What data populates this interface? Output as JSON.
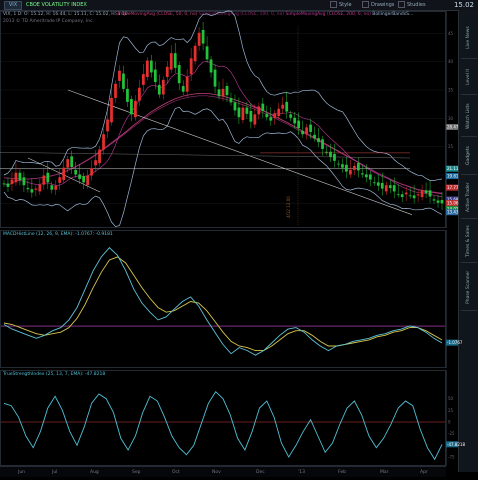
{
  "header": {
    "symbol": "VIX",
    "title": "CBOE VOLATILITY INDEX",
    "tools": [
      "Style",
      "Drawings",
      "Studies"
    ],
    "last_price": "15.02"
  },
  "price_legend": {
    "ohlc": "VIX, 1 D: O: 15.12, H: 16.44, L: 15.11, C: 15.02, H: 1.10",
    "source": "2013 © TD Ameritrade IP Company, Inc.",
    "studies": [
      "SimpleMovingAvg (CLOSE, 50, 0, no)",
      "SimpleMovingAvg (CLOSE, 100, 0, no)",
      "SimpleMovingAvg (CLOSE, 200, 0, no)",
      "BollingerBandsS..."
    ],
    "annotation": "4/12 12:00",
    "level_tags": [
      "28.47",
      "21.11",
      "19.81",
      "17.77",
      "15.68",
      "15.06",
      "14.02",
      "13.43"
    ]
  },
  "macd_legend": {
    "text": "MACDHistLine (12, 26, 9, EMA): -1.0767: -0.9181",
    "tag": "-1.0767"
  },
  "tsi_legend": {
    "text": "TrueStrengthIndex (25, 13, 7, EMA): -47.8218",
    "tag": "-47.8218"
  },
  "sidebar": [
    "Live News",
    "Level II",
    "Watch Lists",
    "Gadgets",
    "Active Trader",
    "Times & Sales",
    "Phase Scanner"
  ],
  "colors": {
    "up": "#23c23a",
    "down": "#e53030",
    "bb": "#9fb8d8",
    "sma50": "#c0407a",
    "sma100": "#8a2a6a",
    "sma200": "#c03a9a",
    "trend": "#cfcfcf",
    "macd": "#5ec3d8",
    "signal": "#d6c64a",
    "tsi": "#4fc0d6",
    "zero": "#d04ad0",
    "refline": "#d04040"
  },
  "chart_data": [
    {
      "type": "candlestick",
      "title": "VIX",
      "categories": [
        "Jun",
        "Jul",
        "Aug",
        "Sep",
        "Oct",
        "Nov",
        "Dec",
        "'13",
        "Feb",
        "Mar",
        "Apr"
      ],
      "ylim": [
        11,
        47
      ],
      "yticks": [
        45,
        40,
        35,
        30,
        25,
        20,
        15
      ],
      "series": [
        {
          "name": "VIX",
          "values": [
            18.5,
            17.9,
            19.2,
            20.4,
            19.1,
            18.2,
            17.5,
            16.9,
            17.6,
            18.3,
            19.9,
            18.7,
            17.4,
            18.1,
            19.6,
            21.3,
            22.8,
            21.4,
            20.1,
            19.3,
            18.7,
            19.9,
            21.2,
            22.6,
            24.5,
            27.2,
            29.8,
            33.6,
            36.1,
            38.4,
            35.2,
            32.9,
            30.7,
            33.1,
            35.4,
            37.8,
            40.2,
            38.1,
            36.4,
            34.2,
            36.8,
            39.1,
            41.5,
            38.9,
            36.2,
            34.7,
            37.3,
            40.6,
            42.8,
            45.1,
            43.2,
            40.4,
            38.1,
            35.6,
            33.9,
            35.2,
            34.1,
            32.8,
            31.4,
            30.2,
            31.9,
            30.8,
            29.4,
            30.7,
            32.1,
            31.3,
            30.2,
            29.6,
            30.9,
            31.7,
            32.4,
            31.2,
            30.1,
            29.1,
            28.3,
            27.2,
            28.4,
            27.6,
            26.5,
            25.8,
            24.6,
            24.1,
            23.2,
            22.5,
            21.9,
            21.3,
            20.6,
            20.9,
            21.6,
            20.8,
            20.1,
            19.6,
            19.2,
            18.7,
            18.1,
            17.6,
            18.2,
            17.7,
            17.1,
            16.6,
            16.1,
            16.9,
            16.4,
            15.9,
            16.6,
            17.3,
            16.8,
            16.2,
            15.5,
            15.1,
            15.0
          ]
        },
        {
          "name": "SMA 50",
          "values": [
            19.5,
            19.4,
            19.3,
            19.3,
            19.4,
            19.6,
            19.9,
            20.3,
            20.9,
            21.6,
            22.4,
            23.3,
            24.3,
            25.4,
            26.5,
            27.6,
            28.8,
            29.9,
            31.0,
            31.9,
            32.7,
            33.4,
            33.9,
            34.2,
            34.4,
            34.4,
            34.2,
            33.9,
            33.5,
            33.0,
            32.5,
            31.9,
            31.3,
            30.6,
            29.9,
            29.2,
            28.4,
            27.6,
            26.8,
            26.0,
            25.2,
            24.4,
            23.6,
            22.8,
            22.0,
            21.2,
            20.4,
            19.7,
            19.0,
            18.4,
            17.9,
            17.4,
            17.1,
            16.9,
            16.7
          ]
        }
      ]
    },
    {
      "type": "line",
      "title": "MACDHistLine",
      "ylim": [
        -2.6,
        5.6
      ],
      "series": [
        {
          "name": "MACD",
          "values": [
            0.1,
            -0.2,
            -0.4,
            -0.6,
            -0.8,
            -0.6,
            -0.3,
            -0.1,
            0.4,
            1.2,
            2.4,
            3.6,
            4.5,
            5.1,
            4.6,
            3.6,
            2.4,
            1.5,
            0.9,
            0.4,
            0.6,
            1.1,
            1.6,
            1.9,
            1.3,
            0.4,
            -0.4,
            -1.2,
            -1.8,
            -1.4,
            -1.6,
            -1.9,
            -1.6,
            -1.1,
            -0.6,
            -0.2,
            -0.1,
            -0.4,
            -0.9,
            -1.3,
            -1.6,
            -1.3,
            -1.2,
            -1.0,
            -0.9,
            -0.8,
            -0.6,
            -0.5,
            -0.3,
            -0.2,
            0.0,
            -0.1,
            -0.4,
            -0.8,
            -1.1
          ]
        },
        {
          "name": "Signal",
          "values": [
            0.2,
            0.1,
            -0.1,
            -0.3,
            -0.5,
            -0.6,
            -0.5,
            -0.4,
            -0.1,
            0.5,
            1.4,
            2.5,
            3.5,
            4.3,
            4.5,
            4.1,
            3.3,
            2.5,
            1.8,
            1.2,
            0.9,
            1.0,
            1.3,
            1.6,
            1.5,
            1.0,
            0.3,
            -0.4,
            -1.0,
            -1.3,
            -1.4,
            -1.6,
            -1.6,
            -1.3,
            -0.9,
            -0.5,
            -0.3,
            -0.3,
            -0.6,
            -1.0,
            -1.3,
            -1.3,
            -1.2,
            -1.1,
            -1.0,
            -0.9,
            -0.7,
            -0.6,
            -0.4,
            -0.3,
            -0.1,
            -0.1,
            -0.3,
            -0.6,
            -0.9
          ]
        }
      ]
    },
    {
      "type": "line",
      "title": "TrueStrengthIndex",
      "ylim": [
        -90,
        90
      ],
      "yticks": [
        50,
        25,
        0,
        -25,
        -50,
        -75
      ],
      "series": [
        {
          "name": "TSI",
          "values": [
            40,
            35,
            10,
            -30,
            -55,
            -20,
            30,
            55,
            25,
            -20,
            -50,
            -10,
            40,
            60,
            50,
            20,
            -35,
            -60,
            -30,
            20,
            55,
            45,
            10,
            -30,
            -55,
            -70,
            -50,
            -5,
            40,
            65,
            50,
            15,
            -35,
            -60,
            -20,
            30,
            45,
            10,
            -45,
            -75,
            -50,
            -20,
            5,
            -30,
            -65,
            -45,
            -5,
            30,
            45,
            15,
            -30,
            -55,
            -35,
            -5,
            30,
            45,
            35,
            -15,
            -55,
            -80,
            -48
          ]
        }
      ]
    }
  ]
}
